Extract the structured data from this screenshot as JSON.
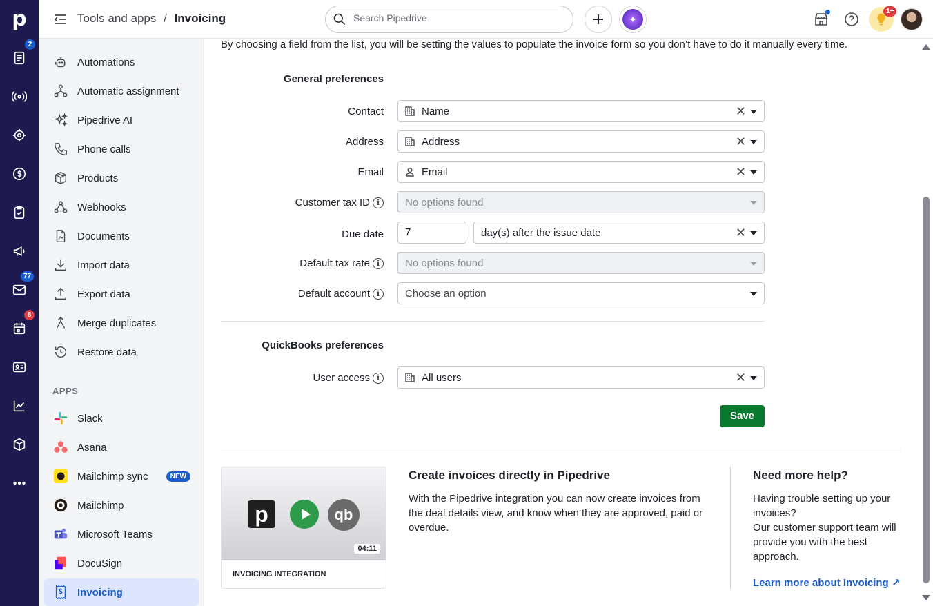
{
  "topbar": {
    "breadcrumb_parent": "Tools and apps",
    "breadcrumb_sep": "/",
    "breadcrumb_current": "Invoicing",
    "search_placeholder": "Search Pipedrive",
    "notification_badge": "1+"
  },
  "rail": {
    "logo": "p",
    "badges": {
      "leads": "2",
      "mail": "77",
      "activities": "8"
    },
    "icons": [
      "leads-icon",
      "deals-icon",
      "campaigns-radar-icon",
      "money-icon",
      "tasks-icon",
      "megaphone-icon",
      "mail-icon",
      "calendar-icon",
      "contacts-icon",
      "insights-icon",
      "products-icon",
      "more-icon"
    ]
  },
  "sidebar": {
    "items": [
      {
        "label": "Automations",
        "icon": "robot-icon"
      },
      {
        "label": "Automatic assignment",
        "icon": "assignment-icon"
      },
      {
        "label": "Pipedrive AI",
        "icon": "sparkle-icon"
      },
      {
        "label": "Phone calls",
        "icon": "phone-icon"
      },
      {
        "label": "Products",
        "icon": "box-icon"
      },
      {
        "label": "Webhooks",
        "icon": "webhook-icon"
      },
      {
        "label": "Documents",
        "icon": "document-icon"
      },
      {
        "label": "Import data",
        "icon": "import-icon"
      },
      {
        "label": "Export data",
        "icon": "export-icon"
      },
      {
        "label": "Merge duplicates",
        "icon": "merge-icon"
      },
      {
        "label": "Restore data",
        "icon": "restore-icon"
      }
    ],
    "apps_heading": "APPS",
    "apps": [
      {
        "label": "Slack",
        "icon": "slack-icon"
      },
      {
        "label": "Asana",
        "icon": "asana-icon"
      },
      {
        "label": "Mailchimp sync",
        "icon": "mailchimp-icon",
        "tag": "NEW"
      },
      {
        "label": "Mailchimp",
        "icon": "mailchimp-icon"
      },
      {
        "label": "Microsoft Teams",
        "icon": "teams-icon"
      },
      {
        "label": "DocuSign",
        "icon": "docusign-icon"
      },
      {
        "label": "Invoicing",
        "icon": "invoice-icon",
        "active": true
      }
    ]
  },
  "main": {
    "intro": "By choosing a field from the list, you will be setting the values to populate the invoice form so you don’t have to do it manually every time.",
    "general_heading": "General preferences",
    "fields": {
      "contact": {
        "label": "Contact",
        "value": "Name"
      },
      "address": {
        "label": "Address",
        "value": "Address"
      },
      "email": {
        "label": "Email",
        "value": "Email"
      },
      "tax_id": {
        "label": "Customer tax ID",
        "value": "No options found"
      },
      "due_date": {
        "label": "Due date",
        "number": "7",
        "value": "day(s) after the issue date"
      },
      "tax_rate": {
        "label": "Default tax rate",
        "value": "No options found"
      },
      "account": {
        "label": "Default account",
        "value": "Choose an option"
      }
    },
    "quickbooks_heading": "QuickBooks preferences",
    "user_access": {
      "label": "User access",
      "value": "All users"
    },
    "save_label": "Save",
    "video": {
      "caption": "INVOICING INTEGRATION",
      "duration": "04:11"
    },
    "promo_title": "Create invoices directly in Pipedrive",
    "promo_text": "With the Pipedrive integration you can now create invoices from the deal details view, and know when they are approved, paid or overdue.",
    "help_title": "Need more help?",
    "help_text_1": "Having trouble setting up your invoices?",
    "help_text_2": "Our customer support team will provide you with the best approach.",
    "help_link": "Learn more about Invoicing ↗"
  },
  "colors": {
    "rail": "#1e1a4f",
    "accent": "#1a5dcc",
    "save": "#08792e"
  }
}
